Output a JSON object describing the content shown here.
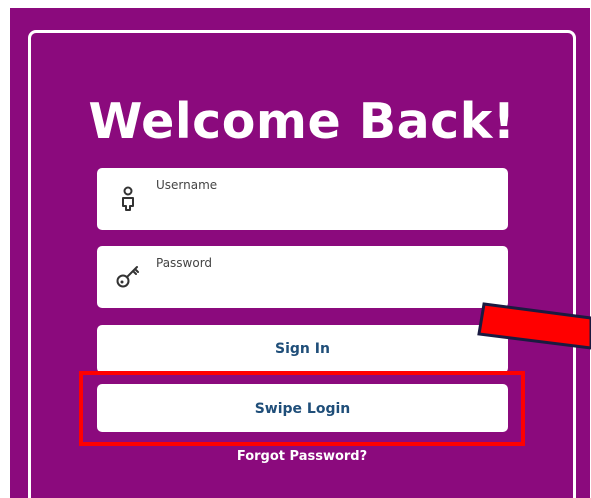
{
  "login": {
    "title": "Welcome Back!",
    "username_label": "Username",
    "password_label": "Password",
    "signin_label": "Sign In",
    "swipe_label": "Swipe Login",
    "forgot_label": "Forgot Password?"
  },
  "icons": {
    "username": "user-icon",
    "password": "key-icon"
  },
  "colors": {
    "background": "#8b0a7d",
    "button_text": "#1f4e79",
    "highlight": "#ff0000",
    "arrow": "#ff0000"
  }
}
